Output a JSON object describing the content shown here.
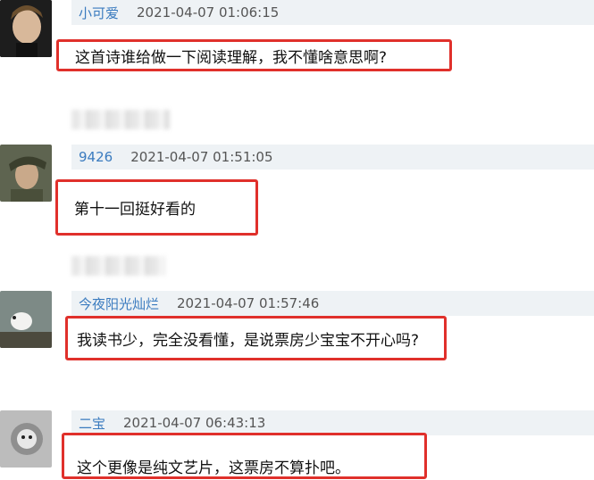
{
  "comments": [
    {
      "username": "小可爱",
      "timestamp": "2021-04-07 01:06:15",
      "text": "这首诗谁给做一下阅读理解，我不懂啥意思啊?"
    },
    {
      "username": "9426",
      "timestamp": "2021-04-07 01:51:05",
      "text": "第十一回挺好看的"
    },
    {
      "username": "今夜阳光灿烂",
      "timestamp": "2021-04-07 01:57:46",
      "text": "我读书少，完全没看懂，是说票房少宝宝不开心吗?"
    },
    {
      "username": "二宝",
      "timestamp": "2021-04-07 06:43:13",
      "text": "这个更像是纯文艺片，这票房不算扑吧。"
    }
  ],
  "colors": {
    "highlight_border": "#e0302b",
    "username": "#3a7bbf",
    "meta_bar": "#eef2f5"
  }
}
